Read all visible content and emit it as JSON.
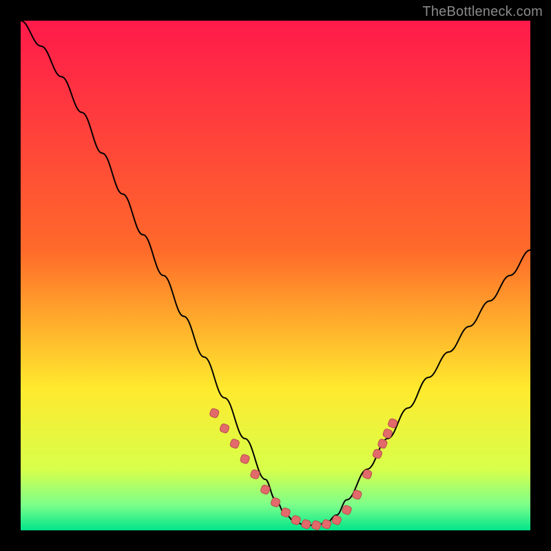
{
  "attribution": "TheBottleneck.com",
  "colors": {
    "bg_black": "#000000",
    "grad_top": "#ff1a4b",
    "grad_mid1": "#ff6a2a",
    "grad_mid2": "#ffe92e",
    "grad_low1": "#d8ff4a",
    "grad_low2": "#7dff8a",
    "grad_bottom": "#00e58a",
    "curve": "#000000",
    "marker_fill": "#e36a6a",
    "marker_stroke": "#b74d4d"
  },
  "chart_data": {
    "type": "line",
    "title": "",
    "xlabel": "",
    "ylabel": "",
    "xlim": [
      0,
      100
    ],
    "ylim": [
      0,
      100
    ],
    "series": [
      {
        "name": "bottleneck-curve",
        "x": [
          0,
          4,
          8,
          12,
          16,
          20,
          24,
          28,
          32,
          36,
          40,
          44,
          48,
          50,
          52,
          54,
          56,
          58,
          60,
          62,
          64,
          68,
          72,
          76,
          80,
          84,
          88,
          92,
          96,
          100
        ],
        "y": [
          100,
          95,
          89,
          82,
          74,
          66,
          58,
          50,
          42,
          34,
          26,
          18,
          10,
          6,
          3,
          1.5,
          1,
          1,
          1.5,
          3,
          6,
          12,
          18,
          24,
          30,
          35,
          40,
          45,
          50,
          55
        ]
      }
    ],
    "markers": {
      "name": "highlight-points",
      "x": [
        38,
        40,
        42,
        44,
        46,
        48,
        50,
        52,
        54,
        56,
        58,
        60,
        62,
        64,
        66,
        68,
        70,
        71,
        72,
        73
      ],
      "y": [
        23,
        20,
        17,
        14,
        11,
        8,
        5.5,
        3.5,
        2,
        1.2,
        1,
        1.2,
        2,
        4,
        7,
        11,
        15,
        17,
        19,
        21
      ]
    },
    "gradient_bands": [
      {
        "y": 100,
        "color": "#ff1a4b"
      },
      {
        "y": 55,
        "color": "#ff9a2a"
      },
      {
        "y": 30,
        "color": "#ffe92e"
      },
      {
        "y": 12,
        "color": "#d8ff4a"
      },
      {
        "y": 5,
        "color": "#7dff8a"
      },
      {
        "y": 0,
        "color": "#00e58a"
      }
    ]
  }
}
